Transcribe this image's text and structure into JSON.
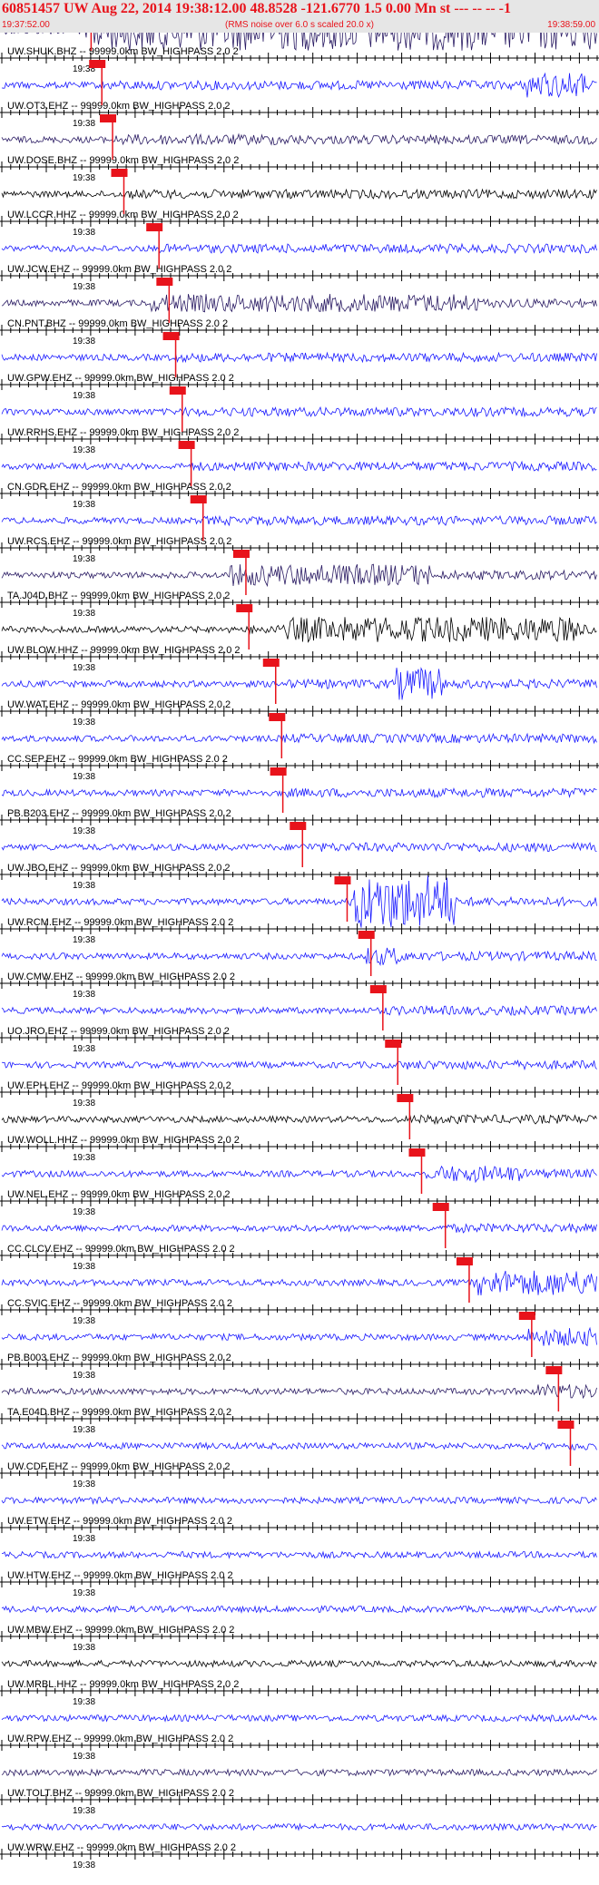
{
  "header": {
    "title": "60851457 UW Aug 22, 2014 19:38:12.00   48.8528 -121.6770  1.5 0.00 Mn st --- -- --   -1",
    "start_time": "19:37:52.00",
    "note": "(RMS noise over 6.0 s scaled 20.0 x)",
    "end_time": "19:38:59.00"
  },
  "minute_label": "19:38",
  "colors": {
    "header_bg": "#e6e6e6",
    "header_text": "#e8131b",
    "pick": "#e8131b",
    "blue": "#1a1aff",
    "black": "#000000",
    "navy": "#2a1b63"
  },
  "traces": [
    {
      "label": "UW.SHUK.BHZ -- 99999.0km BW_HIGHPASS  2.0  2",
      "color": "#2a1b63",
      "pick": 0.15
    },
    {
      "label": "UW.OT3.EHZ -- 99999.0km BW_HIGHPASS  2.0  2",
      "color": "#1a1aff",
      "pick": 0.168
    },
    {
      "label": "UW.DOSE.BHZ -- 99999.0km BW_HIGHPASS  2.0  2",
      "color": "#2a1b63",
      "pick": 0.186
    },
    {
      "label": "UW.LCCR.HHZ -- 99999.0km BW_HIGHPASS  2.0  2",
      "color": "#000000",
      "pick": 0.205
    },
    {
      "label": "UW.JCW.EHZ -- 99999.0km BW_HIGHPASS  2.0  2",
      "color": "#1a1aff",
      "pick": 0.264
    },
    {
      "label": "CN.PNT.BHZ -- 99999.0km BW_HIGHPASS  2.0  2",
      "color": "#2a1b63",
      "pick": 0.281
    },
    {
      "label": "UW.GPW.EHZ -- 99999.0km BW_HIGHPASS  2.0  2",
      "color": "#1a1aff",
      "pick": 0.292
    },
    {
      "label": "UW.RRHS.EHZ -- 99999.0km BW_HIGHPASS  2.0  2",
      "color": "#1a1aff",
      "pick": 0.303
    },
    {
      "label": "CN.GDR.EHZ -- 99999.0km BW_HIGHPASS  2.0  2",
      "color": "#1a1aff",
      "pick": 0.318
    },
    {
      "label": "UW.RCS.EHZ -- 99999.0km BW_HIGHPASS  2.0  2",
      "color": "#1a1aff",
      "pick": 0.338
    },
    {
      "label": "TA.J04D.BHZ -- 99999.0km BW_HIGHPASS  2.0  2",
      "color": "#2a1b63",
      "pick": 0.41
    },
    {
      "label": "UW.BLOW.HHZ -- 99999.0km BW_HIGHPASS  2.0  2",
      "color": "#000000",
      "pick": 0.415
    },
    {
      "label": "UW.WAT.EHZ -- 99999.0km BW_HIGHPASS  2.0  2",
      "color": "#1a1aff",
      "pick": 0.46
    },
    {
      "label": "CC.SEP.EHZ -- 99999.0km BW_HIGHPASS  2.0  2",
      "color": "#1a1aff",
      "pick": 0.47
    },
    {
      "label": "PB.B203.EHZ -- 99999.0km BW_HIGHPASS  2.0  2",
      "color": "#1a1aff",
      "pick": 0.472
    },
    {
      "label": "UW.JBO.EHZ -- 99999.0km BW_HIGHPASS  2.0  2",
      "color": "#1a1aff",
      "pick": 0.505
    },
    {
      "label": "UW.RCM.EHZ -- 99999.0km BW_HIGHPASS  2.0  2",
      "color": "#1a1aff",
      "pick": 0.58
    },
    {
      "label": "UW.CMW.EHZ -- 99999.0km BW_HIGHPASS  2.0  2",
      "color": "#1a1aff",
      "pick": 0.62
    },
    {
      "label": "UO.JRO.EHZ -- 99999.0km BW_HIGHPASS  2.0  2",
      "color": "#1a1aff",
      "pick": 0.64
    },
    {
      "label": "UW.EPH.EHZ -- 99999.0km BW_HIGHPASS  2.0  2",
      "color": "#1a1aff",
      "pick": 0.665
    },
    {
      "label": "UW.WOLL.HHZ -- 99999.0km BW_HIGHPASS  2.0  2",
      "color": "#000000",
      "pick": 0.685
    },
    {
      "label": "UW.NEL.EHZ -- 99999.0km BW_HIGHPASS  2.0  2",
      "color": "#1a1aff",
      "pick": 0.705
    },
    {
      "label": "CC.CLCV.EHZ -- 99999.0km BW_HIGHPASS  2.0  2",
      "color": "#1a1aff",
      "pick": 0.745
    },
    {
      "label": "CC.SVIC.EHZ -- 99999.0km BW_HIGHPASS  2.0  2",
      "color": "#1a1aff",
      "pick": 0.785
    },
    {
      "label": "PB.B003.EHZ -- 99999.0km BW_HIGHPASS  2.0  2",
      "color": "#1a1aff",
      "pick": 0.89
    },
    {
      "label": "TA.E04D.BHZ -- 99999.0km BW_HIGHPASS  2.0  2",
      "color": "#2a1b63",
      "pick": 0.935
    },
    {
      "label": "UW.CDF.EHZ -- 99999.0km BW_HIGHPASS  2.0  2",
      "color": "#1a1aff",
      "pick": 0.955
    },
    {
      "label": "UW.ETW.EHZ -- 99999.0km BW_HIGHPASS  2.0  2",
      "color": "#1a1aff",
      "pick": null
    },
    {
      "label": "UW.HTW.EHZ -- 99999.0km BW_HIGHPASS  2.0  2",
      "color": "#1a1aff",
      "pick": null
    },
    {
      "label": "UW.MBW.EHZ -- 99999.0km BW_HIGHPASS  2.0  2",
      "color": "#1a1aff",
      "pick": null
    },
    {
      "label": "UW.MRBL.HHZ -- 99999.0km BW_HIGHPASS  2.0  2",
      "color": "#000000",
      "pick": null
    },
    {
      "label": "UW.RPW.EHZ -- 99999.0km BW_HIGHPASS  2.0  2",
      "color": "#1a1aff",
      "pick": null
    },
    {
      "label": "UW.TOLT.BHZ -- 99999.0km BW_HIGHPASS  2.0  2",
      "color": "#2a1b63",
      "pick": null
    },
    {
      "label": "UW.WRW.EHZ -- 99999.0km BW_HIGHPASS  2.0  2",
      "color": "#1a1aff",
      "pick": null
    }
  ]
}
